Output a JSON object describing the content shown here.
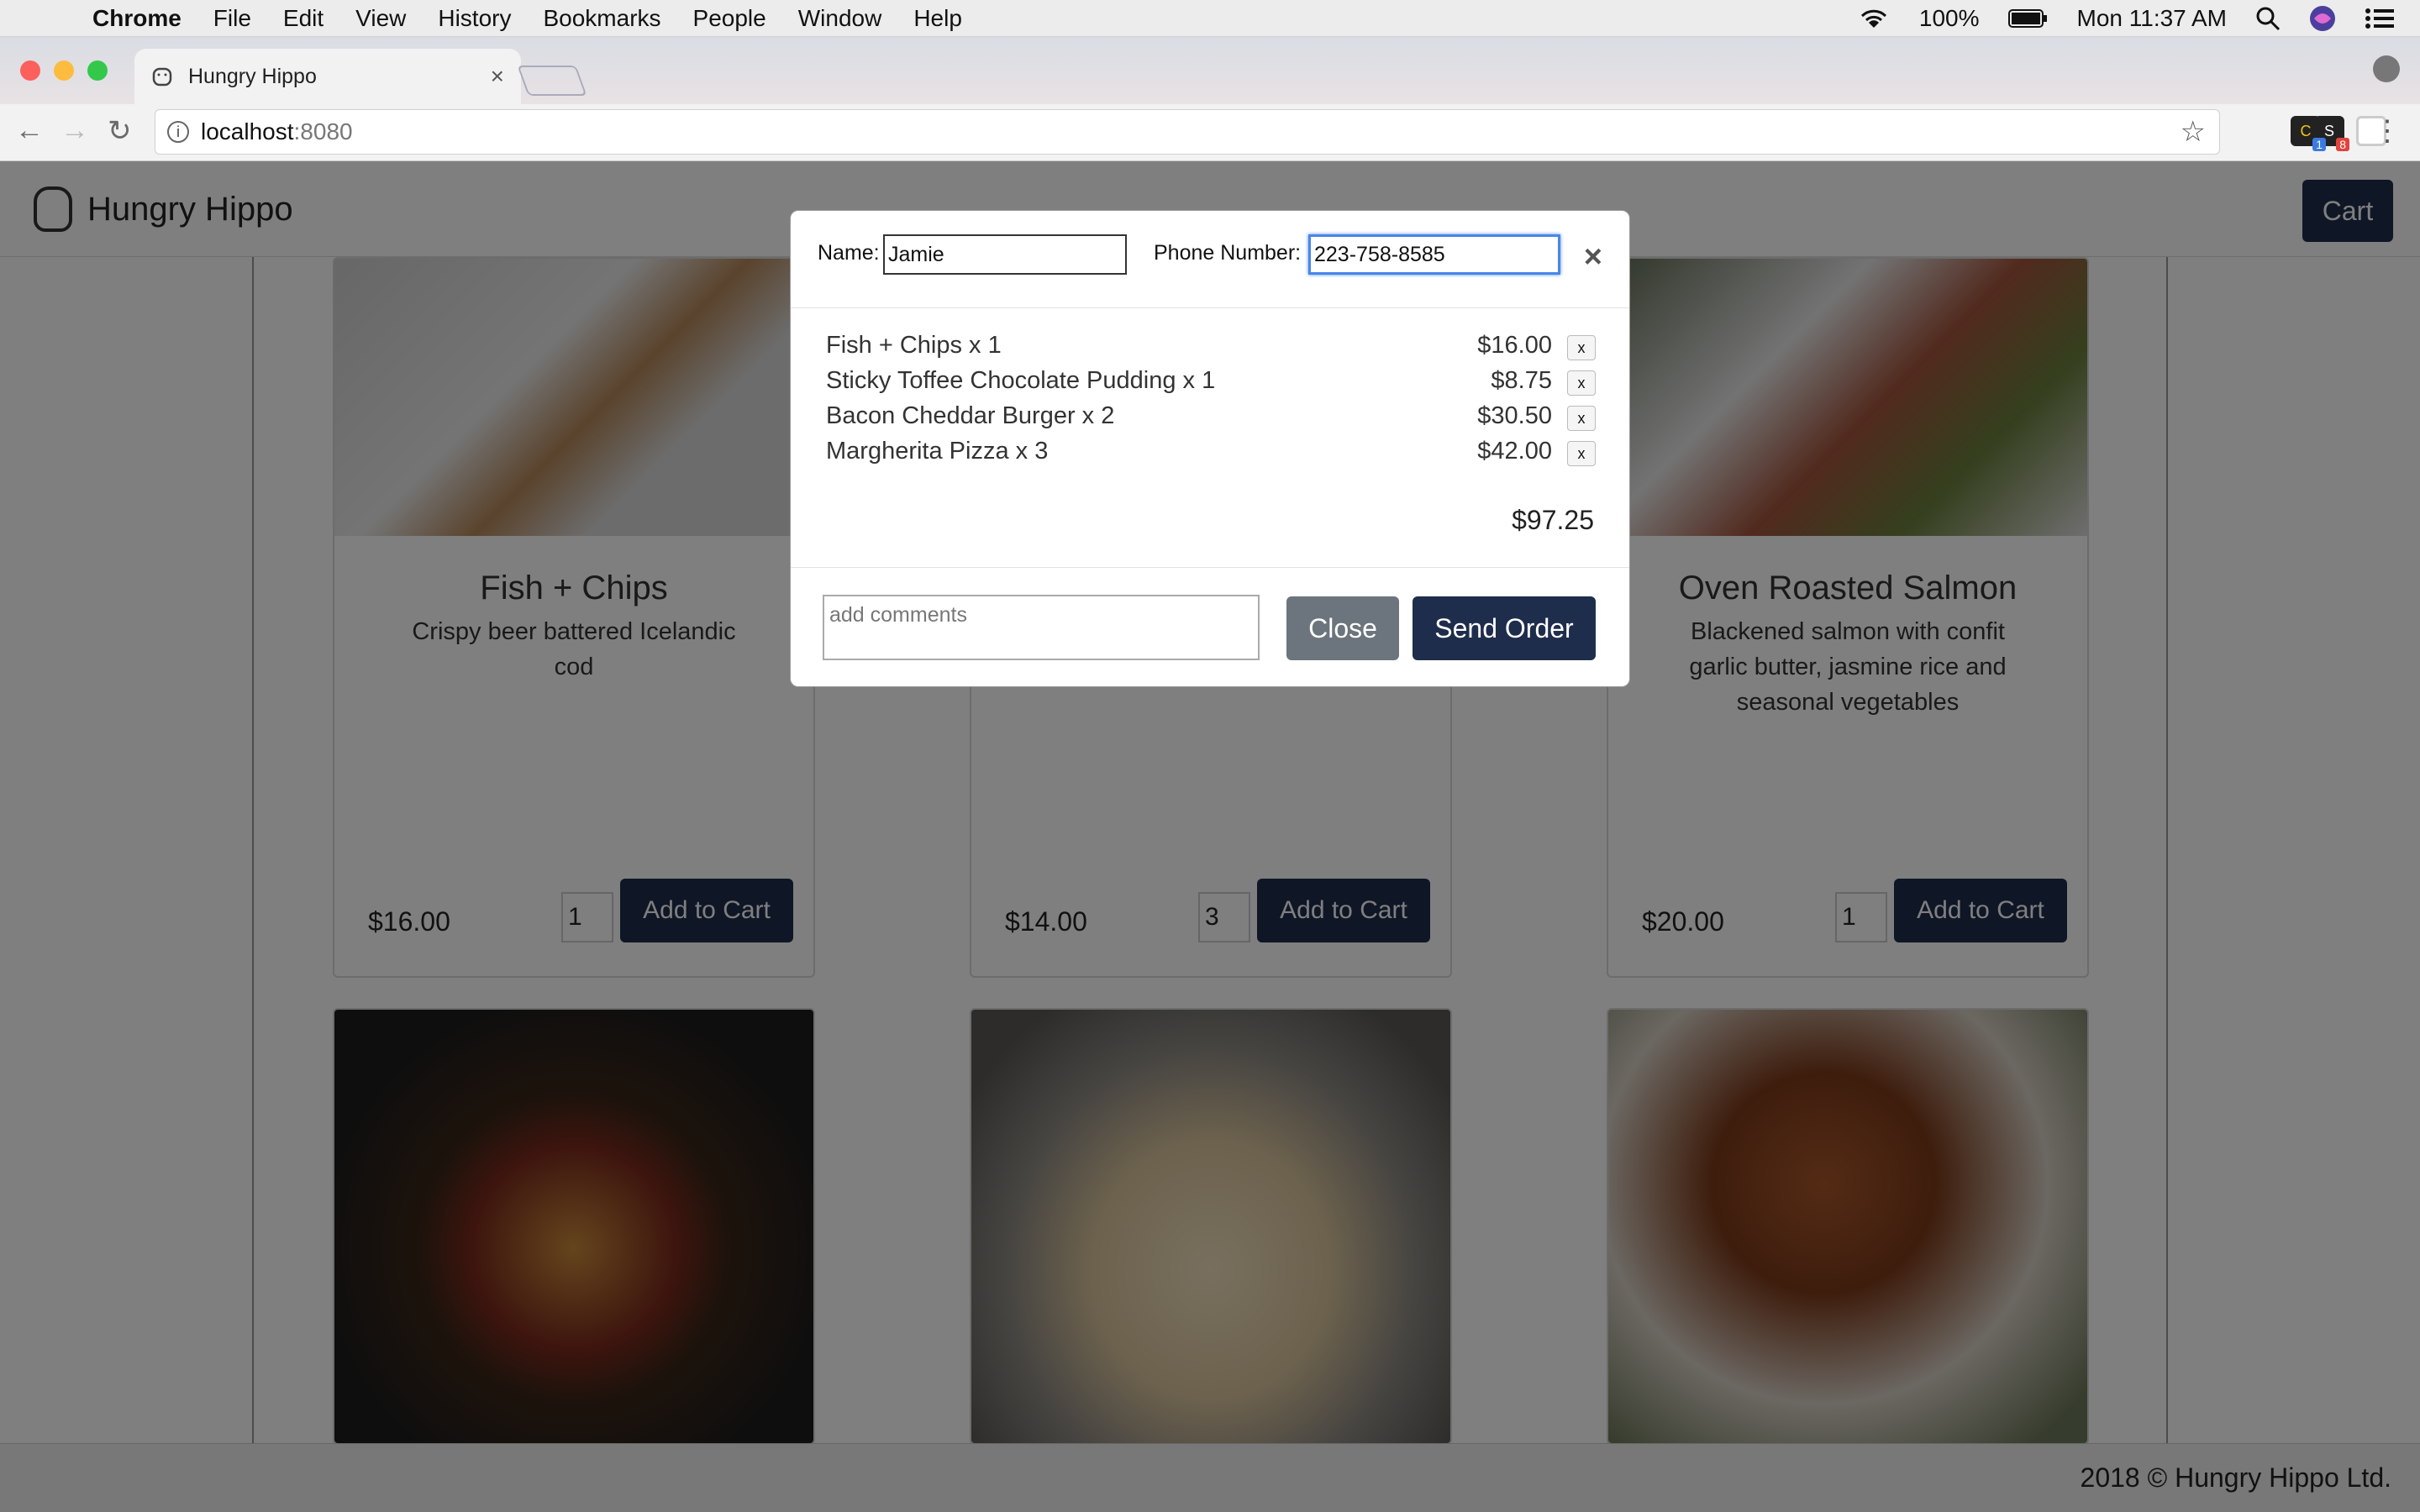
{
  "os_menubar": {
    "app": "Chrome",
    "items": [
      "File",
      "Edit",
      "View",
      "History",
      "Bookmarks",
      "People",
      "Window",
      "Help"
    ],
    "battery": "100%",
    "clock": "Mon 11:37 AM"
  },
  "browser": {
    "tab_title": "Hungry Hippo",
    "url_host": "localhost",
    "url_port": ":8080",
    "ext1_badge": "8",
    "ext2_badge": "1"
  },
  "site": {
    "brand": "Hungry Hippo",
    "cart_label": "Cart",
    "footer": "2018 © Hungry Hippo Ltd."
  },
  "menu_cards": [
    {
      "title": "Fish + Chips",
      "desc": "Crispy beer battered Icelandic cod",
      "price": "$16.00",
      "qty": "1",
      "button": "Add to Cart"
    },
    {
      "title": "",
      "desc": "",
      "price": "$14.00",
      "qty": "3",
      "button": "Add to Cart"
    },
    {
      "title": "Oven Roasted Salmon",
      "desc": "Blackened salmon with confit garlic butter, jasmine rice and seasonal vegetables",
      "price": "$20.00",
      "qty": "1",
      "button": "Add to Cart"
    }
  ],
  "modal": {
    "name_label": "Name:",
    "name_value": "Jamie",
    "phone_label": "Phone Number:",
    "phone_value": "223-758-8585",
    "close_x": "×",
    "items": [
      {
        "label": "Fish + Chips x 1",
        "price": "$16.00",
        "remove": "x"
      },
      {
        "label": "Sticky Toffee Chocolate Pudding x 1",
        "price": "$8.75",
        "remove": "x"
      },
      {
        "label": "Bacon Cheddar Burger x 2",
        "price": "$30.50",
        "remove": "x"
      },
      {
        "label": "Margherita Pizza x 3",
        "price": "$42.00",
        "remove": "x"
      }
    ],
    "total": "$97.25",
    "comments_placeholder": "add comments",
    "close_button": "Close",
    "send_button": "Send Order"
  },
  "colors": {
    "navy": "#1f2d4c",
    "gray_button": "#6c757d",
    "focus_blue": "#4a86e8"
  }
}
